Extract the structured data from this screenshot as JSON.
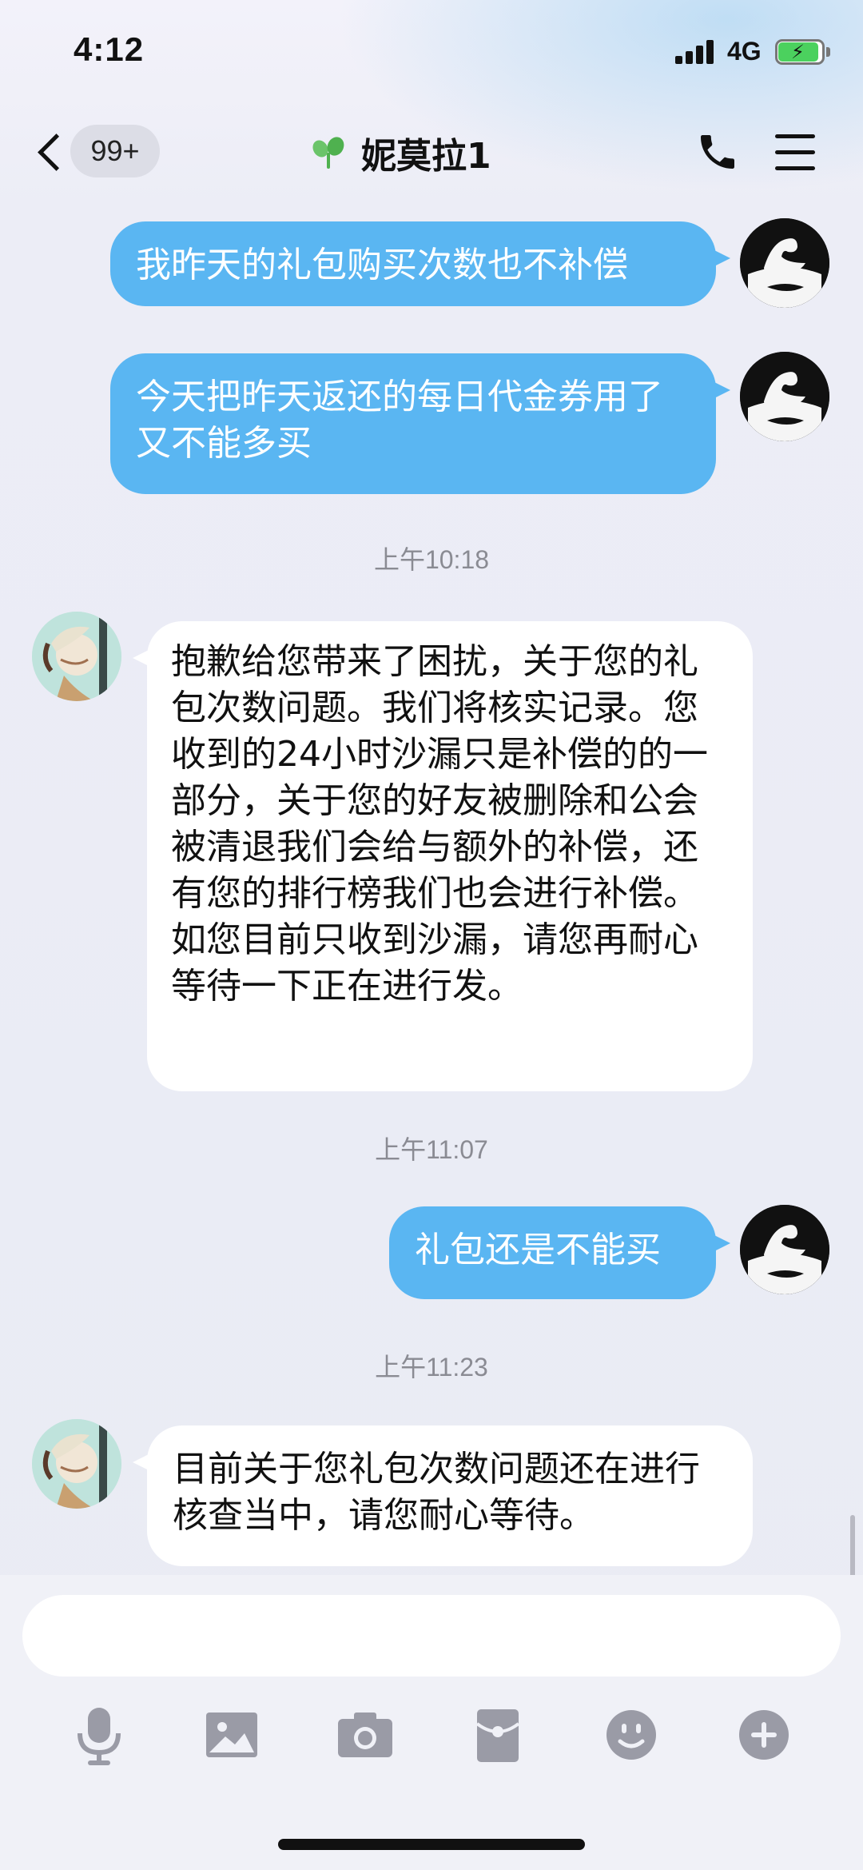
{
  "status_bar": {
    "time": "4:12",
    "network": "4G"
  },
  "nav": {
    "unread_badge": "99+",
    "title": "妮莫拉1"
  },
  "messages": [
    {
      "from": "me",
      "text": "我昨天的礼包购买次数也不补偿"
    },
    {
      "from": "me",
      "text": "今天把昨天返还的每日代金券用了又不能多买"
    },
    {
      "type": "timestamp",
      "text": "上午10:18"
    },
    {
      "from": "them",
      "text": "抱歉给您带来了困扰，关于您的礼包次数问题。我们将核实记录。您收到的24小时沙漏只是补偿的的一部分，关于您的好友被删除和公会被清退我们会给与额外的补偿，还有您的排行榜我们也会进行补偿。如您目前只收到沙漏，请您再耐心等待一下正在进行发。"
    },
    {
      "type": "timestamp",
      "text": "上午11:07"
    },
    {
      "from": "me",
      "text": "礼包还是不能买"
    },
    {
      "type": "timestamp",
      "text": "上午11:23"
    },
    {
      "from": "them",
      "text": "目前关于您礼包次数问题还在进行核查当中，请您耐心等待。"
    }
  ],
  "input": {
    "value": "",
    "placeholder": ""
  },
  "toolbar": [
    "microphone-icon",
    "image-icon",
    "camera-icon",
    "red-packet-icon",
    "emoji-icon",
    "plus-icon"
  ],
  "colors": {
    "my_bubble": "#5ab6f2",
    "their_bubble": "#ffffff",
    "background": "#eceef6",
    "icon_gray": "#9a9ba6"
  }
}
